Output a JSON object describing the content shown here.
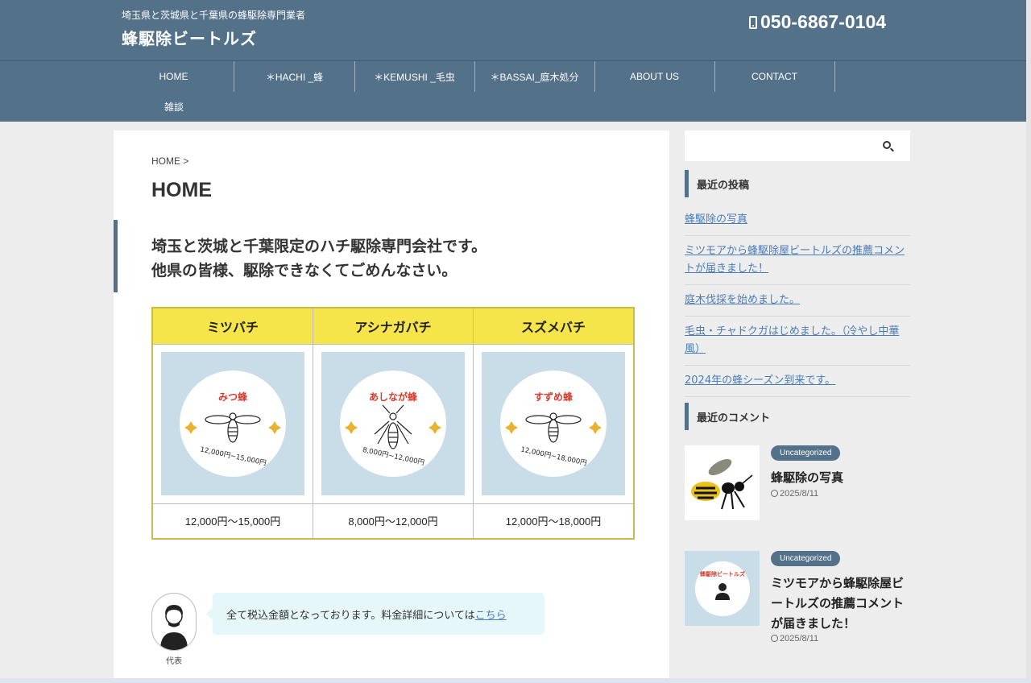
{
  "header": {
    "tagline": "埼玉県と茨城県と千葉県の蜂駆除専門業者",
    "site_title": "蜂駆除ビートルズ",
    "phone": "050-6867-0104"
  },
  "nav": {
    "items": [
      {
        "label": "HOME"
      },
      {
        "label": "＊HACHI _蜂"
      },
      {
        "label": "＊KEMUSHI _毛虫"
      },
      {
        "label": "＊BASSAI_庭木処分"
      },
      {
        "label": "ABOUT US"
      },
      {
        "label": "CONTACT"
      },
      {
        "label": "雑談"
      }
    ]
  },
  "main": {
    "breadcrumb": "HOME >",
    "page_title": "HOME",
    "lead_line1": "埼玉と茨城と千葉限定のハチ駆除専門会社です。",
    "lead_line2": "他県の皆様、駆除できなくてごめんなさい。",
    "bees": [
      {
        "name": "ミツバチ",
        "badge_label": "みつ蜂",
        "badge_color": "#d93a2b",
        "badge_price": "12,000円~15,000円",
        "price": "12,000円〜15,000円"
      },
      {
        "name": "アシナガバチ",
        "badge_label": "あしなが蜂",
        "badge_color": "#d93a2b",
        "badge_price": "8,000円~12,000円",
        "price": "8,000円〜12,000円"
      },
      {
        "name": "スズメバチ",
        "badge_label": "すずめ蜂",
        "badge_color": "#d93a2b",
        "badge_price": "12,000円~18,000円",
        "price": "12,000円〜18,000円"
      }
    ],
    "speech_text": "全て税込金額となっております。料金詳細については",
    "speech_link": "こちら",
    "avatar_label": "代表"
  },
  "sidebar": {
    "recent_posts_heading": "最近の投稿",
    "recent_posts": [
      "蜂駆除の写真",
      "ミツモアから蜂駆除屋ビートルズの推薦コメントが届きました！",
      "庭木伐採を始めました。",
      "毛虫・チャドクガはじめました。（冷やし中華風）",
      "2024年の蜂シーズン到来です。"
    ],
    "recent_comments_heading": "最近のコメント",
    "comments": [
      {
        "category": "Uncategorized",
        "title": "蜂駆除の写真",
        "date": "2025/8/11"
      },
      {
        "category": "Uncategorized",
        "title": "ミツモアから蜂駆除屋ビートルズの推薦コメントが届きました！",
        "date": "2025/8/11",
        "thumb_text": "蜂駆除ビートルズ"
      }
    ]
  },
  "colors": {
    "header_bg": "#54718a",
    "table_header_bg": "#f5e54b",
    "link": "#4a7cb5",
    "bee_card_bg": "#c9dde8"
  }
}
